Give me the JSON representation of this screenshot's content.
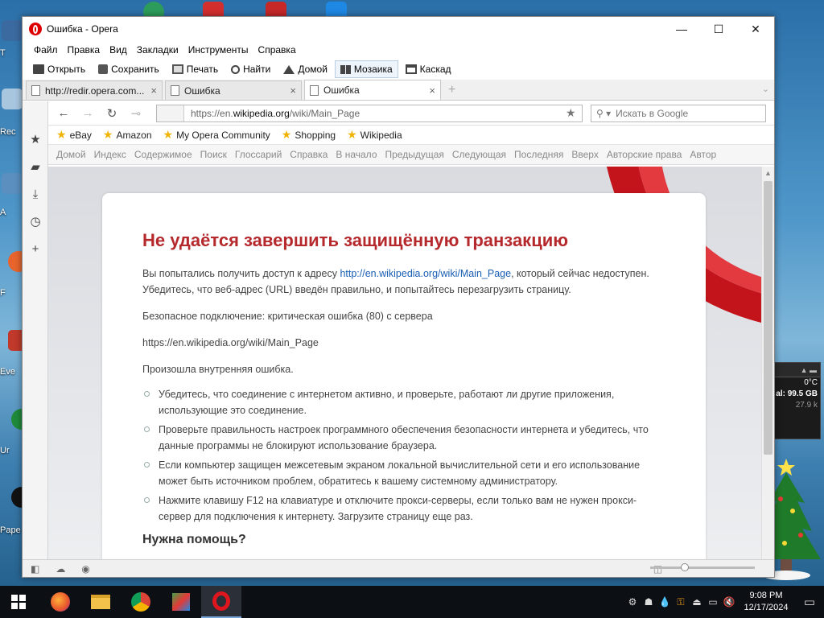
{
  "window": {
    "title": "Ошибка - Opera"
  },
  "menu": [
    "Файл",
    "Правка",
    "Вид",
    "Закладки",
    "Инструменты",
    "Справка"
  ],
  "toolbar": {
    "open": "Открыть",
    "save": "Сохранить",
    "print": "Печать",
    "find": "Найти",
    "home": "Домой",
    "tile": "Мозаика",
    "cascade": "Каскад"
  },
  "tabs": [
    {
      "label": "http://redir.opera.com..."
    },
    {
      "label": "Ошибка"
    },
    {
      "label": "Ошибка"
    }
  ],
  "address": {
    "url_prefix": "https://en.",
    "url_domain": "wikipedia.org",
    "url_path": "/wiki/Main_Page",
    "search_placeholder": "Искать в Google"
  },
  "bookmarks": [
    "eBay",
    "Amazon",
    "My Opera Community",
    "Shopping",
    "Wikipedia"
  ],
  "navbar": [
    "Домой",
    "Индекс",
    "Содержимое",
    "Поиск",
    "Глоссарий",
    "Справка",
    "В начало",
    "Предыдущая",
    "Следующая",
    "Последняя",
    "Вверх",
    "Авторские права",
    "Автор"
  ],
  "error": {
    "title": "Не удаётся завершить защищённую транзакцию",
    "intro_before": "Вы попытались получить доступ к адресу ",
    "intro_link": "http://en.wikipedia.org/wiki/Main_Page",
    "intro_after": ", который сейчас недоступен. Убедитесь, что веб-адрес (URL) введён правильно, и попытайтесь перезагрузить страницу.",
    "secure": "Безопасное подключение: критическая ошибка (80) с сервера",
    "server_url": "https://en.wikipedia.org/wiki/Main_Page",
    "internal": "Произошла внутренняя ошибка.",
    "tips": [
      "Убедитесь, что соединение с интернетом активно, и проверьте, работают ли другие приложения, использующие это соединение.",
      "Проверьте правильность настроек программного обеспечения безопасности интернета и убедитесь, что данные программы не блокируют использование браузера.",
      "Если компьютер защищен межсетевым экраном локальной вычислительной сети и его использование может быть источником проблем, обратитесь к вашему системному администратору.",
      "Нажмите клавишу F12 на клавиатуре и отключите прокси-серверы, если только вам не нужен прокси-сервер для подключения к интернету. Загрузите страницу еще раз."
    ],
    "help": "Нужна помощь?"
  },
  "desktop_labels": [
    "T",
    "Rec",
    "A",
    "F",
    "Eve",
    "Ur",
    "Pape"
  ],
  "widget": {
    "temp": "0°C",
    "disk": "al: 99.5 GB",
    "net": "27.9 k"
  },
  "clock": {
    "time": "9:08 PM",
    "date": "12/17/2024"
  },
  "colors": {
    "opera_red": "#cc0f16",
    "error_title": "#b5282c",
    "link": "#1a5fb4",
    "taskbar": "#0c0f14"
  }
}
